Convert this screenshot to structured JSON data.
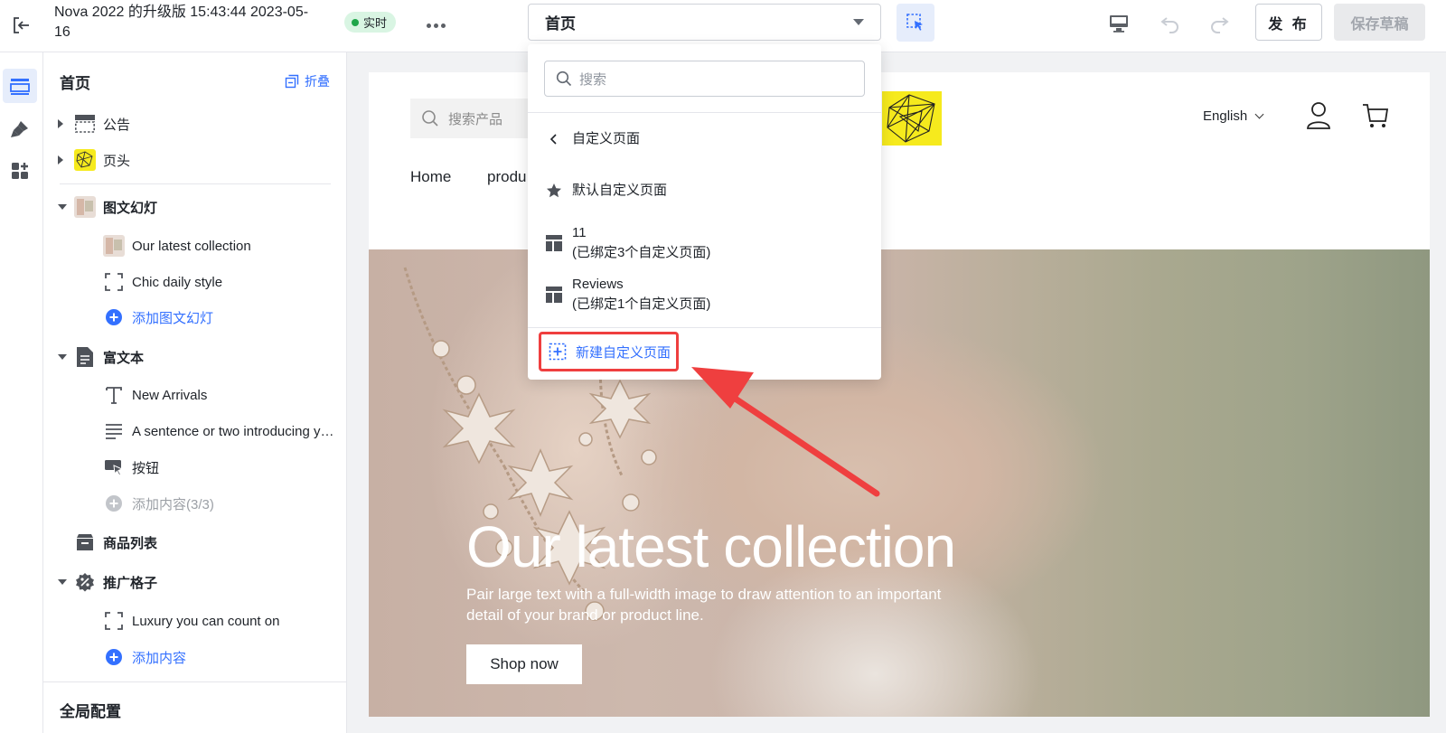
{
  "topbar": {
    "title": "Nova 2022 的升级版 15:43:44 2023-05-16",
    "live_badge": "实时",
    "page_select_value": "首页",
    "publish_label": "发 布",
    "save_draft_label": "保存草稿"
  },
  "rail": {
    "items": [
      "sections-icon",
      "theme-brush-icon",
      "apps-icon"
    ]
  },
  "sidebar": {
    "title": "首页",
    "fold_label": "折叠",
    "tree": {
      "announcement": "公告",
      "header": "页头",
      "slideshow": "图文幻灯",
      "slide_1": "Our latest collection",
      "slide_2": "Chic daily style",
      "add_slide": "添加图文幻灯",
      "rich_text": "富文本",
      "rt_heading": "New Arrivals",
      "rt_text": "A sentence or two introducing your brand or product line.",
      "rt_button": "按钮",
      "add_content_limited": "添加内容(3/3)",
      "product_list": "商品列表",
      "promo_grid": "推广格子",
      "promo_item": "Luxury you can count on",
      "add_content": "添加内容"
    },
    "global_config": "全局配置"
  },
  "dropdown": {
    "search_placeholder": "搜索",
    "back_label": "自定义页面",
    "default_label": "默认自定义页面",
    "templates": [
      {
        "name": "11",
        "sub": "(已绑定3个自定义页面)"
      },
      {
        "name": "Reviews",
        "sub": "(已绑定1个自定义页面)"
      }
    ],
    "new_label": "新建自定义页面"
  },
  "preview": {
    "search_placeholder": "搜索产品",
    "language": "English",
    "nav": [
      "Home",
      "produ"
    ],
    "hero_title": "Our latest collection",
    "hero_subtitle": "Pair large text with a full-width image to draw attention to an important detail of your brand or product line.",
    "hero_button": "Shop now"
  },
  "colors": {
    "accent": "#3370ff",
    "live_green": "#1fa64a",
    "highlight_red": "#ef3f3f"
  }
}
